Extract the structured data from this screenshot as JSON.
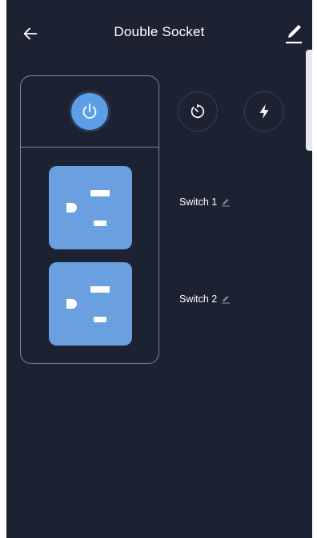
{
  "header": {
    "title": "Double Socket",
    "back_icon": "arrow-left-icon",
    "edit_icon": "pencil-icon"
  },
  "panel": {
    "power_icon": "power-icon",
    "outlets": [
      {
        "name": "outlet-1",
        "icon": "outlet-icon"
      },
      {
        "name": "outlet-2",
        "icon": "outlet-icon"
      }
    ]
  },
  "actions": {
    "timer_icon": "timer-icon",
    "power_stats_icon": "lightning-icon"
  },
  "switches": [
    {
      "label": "Switch 1",
      "edit_icon": "small-pencil-icon"
    },
    {
      "label": "Switch 2",
      "edit_icon": "small-pencil-icon"
    }
  ],
  "colors": {
    "background": "#1d2233",
    "accent": "#5d9ee6",
    "outlet": "#6a9fe0",
    "panel_border": "#7d8499"
  }
}
